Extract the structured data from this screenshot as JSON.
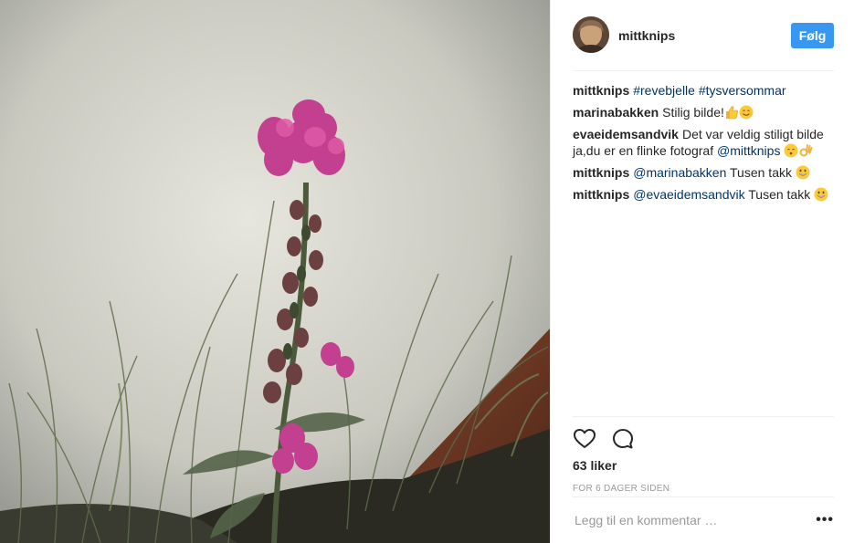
{
  "post": {
    "username": "mittknips",
    "follow_label": "Følg"
  },
  "comments": [
    {
      "author": "mittknips",
      "parts": [
        {
          "tag": "#revebjelle"
        },
        {
          "text": " "
        },
        {
          "tag": "#tysversommar"
        }
      ]
    },
    {
      "author": "marinabakken",
      "parts": [
        {
          "text": "Stilig bilde!"
        }
      ],
      "emojis": [
        "thumbs-up",
        "smile"
      ]
    },
    {
      "author": "evaeidemsandvik",
      "parts": [
        {
          "text": "Det var veldig stiligt bilde ja,du er en flinke fotograf "
        },
        {
          "tag": "@mittknips"
        },
        {
          "text": " "
        }
      ],
      "emojis": [
        "kiss",
        "ok-hand"
      ]
    },
    {
      "author": "mittknips",
      "parts": [
        {
          "tag": "@marinabakken"
        },
        {
          "text": " Tusen takk "
        }
      ],
      "emojis": [
        "grin"
      ]
    },
    {
      "author": "mittknips",
      "parts": [
        {
          "tag": "@evaeidemsandvik"
        },
        {
          "text": " Tusen takk "
        }
      ],
      "emojis": [
        "grin"
      ]
    }
  ],
  "actions": {
    "likes": "63 liker",
    "time": "FOR 6 DAGER SIDEN"
  },
  "comment_box": {
    "placeholder": "Legg til en kommentar …",
    "more": "•••"
  },
  "icons": {
    "like": "heart-icon",
    "comment": "comment-bubble-icon"
  }
}
